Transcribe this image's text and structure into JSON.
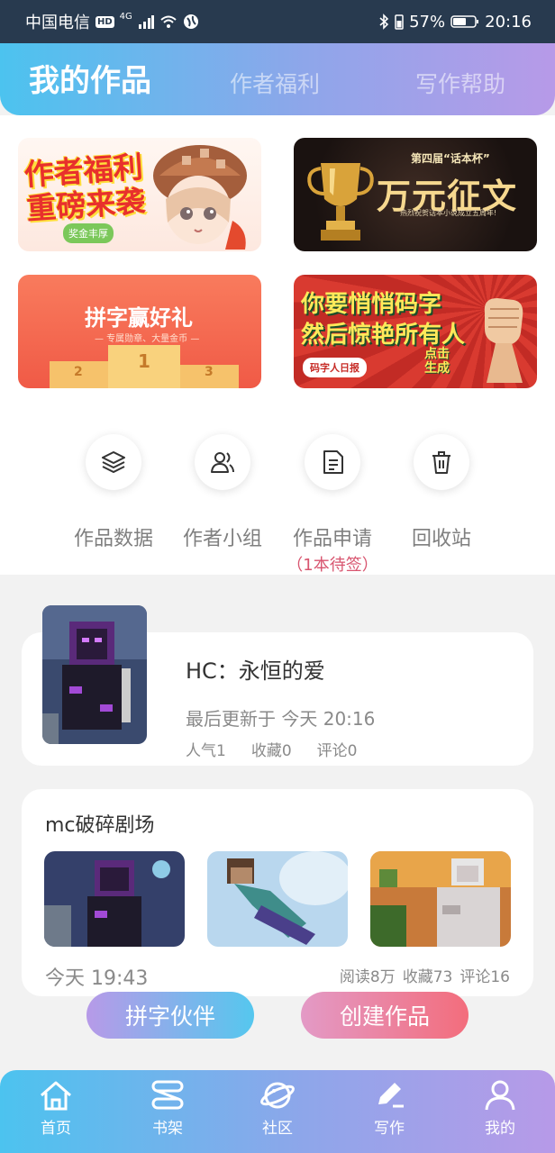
{
  "status_bar": {
    "carrier": "中国电信",
    "hd": "HD",
    "network": "4G",
    "battery_pct": "57%",
    "time": "20:16"
  },
  "header": {
    "tabs": [
      {
        "label": "我的作品",
        "active": true
      },
      {
        "label": "作者福利",
        "active": false
      },
      {
        "label": "写作帮助",
        "active": false
      }
    ]
  },
  "banners": [
    {
      "title_line1": "作者福利",
      "title_line2": "重磅来袭",
      "tag": "奖金丰厚"
    },
    {
      "edition": "第四届“话本杯”",
      "title": "万元征文",
      "sub": "热烈祝贺话本小说成立五周年!"
    },
    {
      "title": "拼字赢好礼",
      "sub": "— 专属勋章、大量金币 —",
      "ranks": [
        "2",
        "1",
        "3"
      ]
    },
    {
      "title_line1": "你要悄悄码字",
      "title_line2": "然后惊艳所有人",
      "tag": "码字人日报",
      "cta": "点击生成"
    }
  ],
  "quick_actions": [
    {
      "label": "作品数据",
      "icon": "layers-icon"
    },
    {
      "label": "作者小组",
      "icon": "group-icon"
    },
    {
      "label": "作品申请",
      "icon": "document-icon",
      "note": "（1本待签）"
    },
    {
      "label": "回收站",
      "icon": "trash-icon"
    }
  ],
  "work": {
    "title": "HC：永恒的爱",
    "updated": "最后更新于 今天 20:16",
    "popularity": "人气1",
    "favorites": "收藏0",
    "comments": "评论0"
  },
  "theater": {
    "title": "mc破碎剧场",
    "time": "今天 19:43",
    "reads": "阅读8万",
    "favorites": "收藏73",
    "comments": "评论16"
  },
  "floating_buttons": {
    "partner": "拼字伙伴",
    "create": "创建作品"
  },
  "bottom_nav": [
    {
      "label": "首页",
      "icon": "home-icon"
    },
    {
      "label": "书架",
      "icon": "bookshelf-icon"
    },
    {
      "label": "社区",
      "icon": "planet-icon"
    },
    {
      "label": "写作",
      "icon": "pen-icon",
      "active": true
    },
    {
      "label": "我的",
      "icon": "user-icon"
    }
  ]
}
